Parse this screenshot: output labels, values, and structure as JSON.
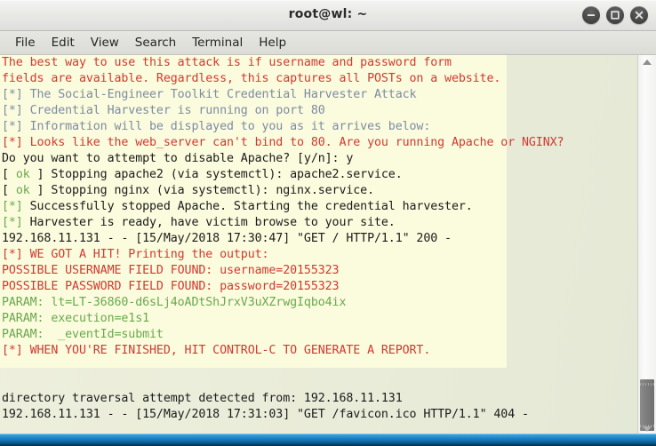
{
  "window": {
    "title": "root@wl: ~",
    "buttons": [
      {
        "name": "minimize",
        "glyph": "minimize-icon"
      },
      {
        "name": "maximize",
        "glyph": "maximize-icon"
      },
      {
        "name": "close",
        "glyph": "close-icon"
      }
    ]
  },
  "menubar": {
    "items": [
      {
        "label": "File"
      },
      {
        "label": "Edit"
      },
      {
        "label": "View"
      },
      {
        "label": "Search"
      },
      {
        "label": "Terminal"
      },
      {
        "label": "Help"
      }
    ]
  },
  "terminal": {
    "colors": {
      "red": "#d03a31",
      "blue_gray": "#7d8ba3",
      "green": "#6aa84f",
      "black": "#1b1b1b",
      "background": "#fbfbdd",
      "background_outer": "#e8ebd8"
    },
    "lines": [
      {
        "segments": [
          {
            "text": "The best way to use this attack is if username and password form",
            "color": "red"
          }
        ]
      },
      {
        "segments": [
          {
            "text": "fields are available. Regardless, this captures all POSTs on a website.",
            "color": "red"
          }
        ]
      },
      {
        "segments": [
          {
            "text": "[*] The Social-Engineer Toolkit Credential Harvester Attack",
            "color": "blue_gray"
          }
        ]
      },
      {
        "segments": [
          {
            "text": "[*] Credential Harvester is running on port 80",
            "color": "blue_gray"
          }
        ]
      },
      {
        "segments": [
          {
            "text": "[*] Information will be displayed to you as it arrives below:",
            "color": "blue_gray"
          }
        ]
      },
      {
        "segments": [
          {
            "text": "[*] Looks like the web_server can't bind to 80. Are you running Apache or NGINX?",
            "color": "red"
          }
        ]
      },
      {
        "segments": [
          {
            "text": "Do you want to attempt to disable Apache? [y/n]: y",
            "color": "black"
          }
        ]
      },
      {
        "segments": [
          {
            "text": "[ ",
            "color": "black"
          },
          {
            "text": "ok",
            "color": "green"
          },
          {
            "text": " ] Stopping apache2 (via systemctl): apache2.service.",
            "color": "black"
          }
        ]
      },
      {
        "segments": [
          {
            "text": "[ ",
            "color": "black"
          },
          {
            "text": "ok",
            "color": "green"
          },
          {
            "text": " ] Stopping nginx (via systemctl): nginx.service.",
            "color": "black"
          }
        ]
      },
      {
        "segments": [
          {
            "text": "[*]",
            "color": "green"
          },
          {
            "text": " Successfully stopped Apache. Starting the credential harvester.",
            "color": "black"
          }
        ]
      },
      {
        "segments": [
          {
            "text": "[*]",
            "color": "green"
          },
          {
            "text": " Harvester is ready, have victim browse to your site.",
            "color": "black"
          }
        ]
      },
      {
        "segments": [
          {
            "text": "192.168.11.131 - - [15/May/2018 17:30:47] \"GET / HTTP/1.1\" 200 -",
            "color": "black"
          }
        ]
      },
      {
        "segments": [
          {
            "text": "[*] WE GOT A HIT! Printing the output:",
            "color": "red"
          }
        ]
      },
      {
        "segments": [
          {
            "text": "POSSIBLE USERNAME FIELD FOUND: username=20155323",
            "color": "red"
          }
        ]
      },
      {
        "segments": [
          {
            "text": "POSSIBLE PASSWORD FIELD FOUND: password=20155323",
            "color": "red"
          }
        ]
      },
      {
        "segments": [
          {
            "text": "PARAM: lt=LT-36860-d6sLj4oADtShJrxV3uXZrwgIqbo4ix",
            "color": "green"
          }
        ]
      },
      {
        "segments": [
          {
            "text": "PARAM: execution=e1s1",
            "color": "green"
          }
        ]
      },
      {
        "segments": [
          {
            "text": "PARAM:  _eventId=submit",
            "color": "green"
          }
        ]
      },
      {
        "segments": [
          {
            "text": "[*] WHEN YOU'RE FINISHED, HIT CONTROL-C TO GENERATE A REPORT.",
            "color": "red"
          }
        ]
      },
      {
        "segments": [
          {
            "text": "",
            "color": "black"
          }
        ]
      },
      {
        "segments": [
          {
            "text": "",
            "color": "black"
          }
        ]
      },
      {
        "segments": [
          {
            "text": "directory traversal attempt detected from: 192.168.11.131",
            "color": "black"
          }
        ]
      },
      {
        "segments": [
          {
            "text": "192.168.11.131 - - [15/May/2018 17:31:03] \"GET /favicon.ico HTTP/1.1\" 404 -",
            "color": "black"
          }
        ]
      }
    ]
  },
  "scrollbar": {
    "up_arrow": "scroll-up-icon",
    "down_arrow": "scroll-down-icon"
  }
}
